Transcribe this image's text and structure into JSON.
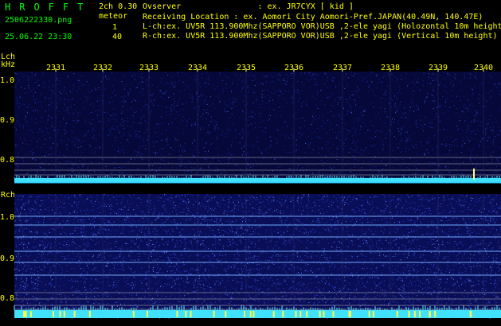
{
  "header": {
    "logo": "HROFFT",
    "filename": "2506222330.png",
    "datetime": "25.06.22 23:30",
    "channel_mode": "2ch 0.30",
    "meteor_label": "meteor",
    "lch_count": "1",
    "rch_count": "40",
    "observer": "Ovserver                : ex. JR7CYX [ kid ]",
    "location": "Receiving Location : ex. Aomori City Aomori-Pref.JAPAN(40.49N, 140.47E)",
    "lch_desc": "L-ch:ex. UV5R 113.900Mhz(SAPPORO VOR)USB ,2-ele yagi (Holozontal 10m height",
    "rch_desc": "R-ch:ex. UV5R 113.900Mhz(SAPPORO VOR)USB ,2-ele yagi (Vertical 10m height)"
  },
  "panels": {
    "lch_label": "Lch",
    "khz_label": "kHz",
    "rch_label": "Rch"
  },
  "time_ticks": [
    "2331",
    "2332",
    "2333",
    "2334",
    "2335",
    "2336",
    "2337",
    "2338",
    "2339",
    "2340"
  ],
  "freq_ticks": [
    "1.0",
    "0.9",
    "0.8"
  ],
  "colors": {
    "background": "#000000",
    "header_text": "#00ff00",
    "counts_text": "#ffff00",
    "info_text": "#ffffff",
    "waterfall_low": "#0a0a50",
    "waterfall_high": "#4fd8ff",
    "baseline": "#40e0ff"
  }
}
